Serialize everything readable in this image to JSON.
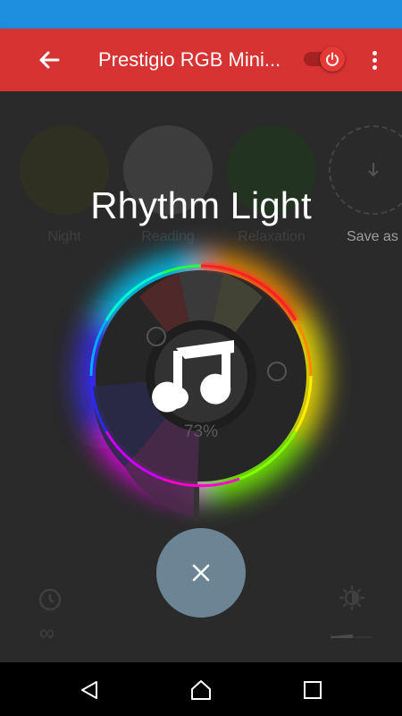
{
  "app_bar": {
    "title": "Prestigio RGB Mini...",
    "power_on": true
  },
  "presets": [
    {
      "label": "Night",
      "color": "#2f2f22"
    },
    {
      "label": "Reading",
      "color": "#3d3d3d"
    },
    {
      "label": "Relaxation",
      "color": "#223322"
    }
  ],
  "save_as_label": "Save as",
  "overlay": {
    "title": "Rhythm Light",
    "brightness_percent": "73%"
  },
  "bottom": {
    "timer_value": "∞",
    "brightness_level": 0.55
  },
  "colors": {
    "status_bar": "#1e8fdc",
    "app_bar": "#d83333",
    "fab": "#6b8595",
    "background": "#2a2a2a"
  },
  "icons": {
    "back": "arrow-left-icon",
    "power": "power-icon",
    "more": "more-vert-icon",
    "music": "music-note-icon",
    "close": "close-icon",
    "timer": "timer-icon",
    "brightness": "brightness-icon"
  }
}
